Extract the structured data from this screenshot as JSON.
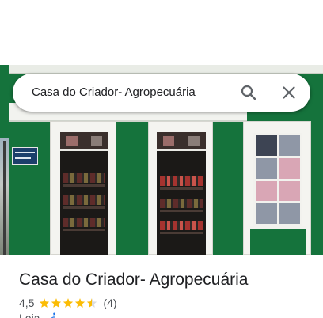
{
  "search": {
    "query": "Casa do Criador- Agropecuária"
  },
  "photo": {
    "sign_phone": "99953-3594 / 99828-3002"
  },
  "place": {
    "title": "Casa do Criador- Agropecuária",
    "rating": "4,5",
    "rating_stars": 4.5,
    "review_count": "(4)",
    "category": "Loja",
    "category_separator": "·"
  },
  "icons": {
    "search": "search-icon",
    "close": "close-icon",
    "star": "star-icon",
    "wheelchair": "wheelchair-icon"
  },
  "colors": {
    "star": "#fbbc04",
    "facade_green": "#15733c",
    "title": "#202124",
    "secondary_text": "#4d5156",
    "icon_gray": "#5f6368"
  }
}
